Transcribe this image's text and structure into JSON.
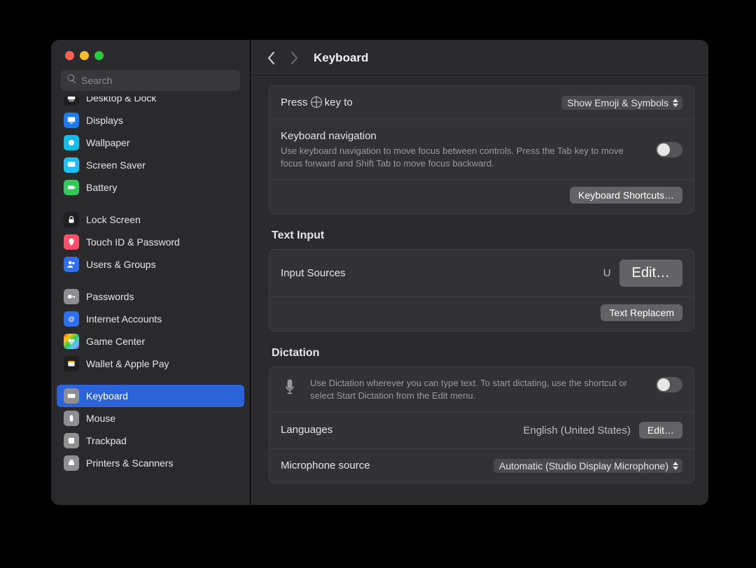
{
  "window": {
    "title": "Keyboard"
  },
  "search": {
    "placeholder": "Search"
  },
  "sidebar": {
    "items": [
      {
        "id": "desktop-dock",
        "label": "Desktop & Dock",
        "icon": "dock",
        "cutoff": true
      },
      {
        "id": "displays",
        "label": "Displays",
        "icon": "disp"
      },
      {
        "id": "wallpaper",
        "label": "Wallpaper",
        "icon": "wall"
      },
      {
        "id": "screensaver",
        "label": "Screen Saver",
        "icon": "ss"
      },
      {
        "id": "battery",
        "label": "Battery",
        "icon": "batt"
      },
      {
        "spacer": true
      },
      {
        "id": "lockscreen",
        "label": "Lock Screen",
        "icon": "lock"
      },
      {
        "id": "touchid",
        "label": "Touch ID & Password",
        "icon": "touch"
      },
      {
        "id": "users",
        "label": "Users & Groups",
        "icon": "users"
      },
      {
        "spacer": true
      },
      {
        "id": "passwords",
        "label": "Passwords",
        "icon": "pass"
      },
      {
        "id": "internet-accounts",
        "label": "Internet Accounts",
        "icon": "netacc"
      },
      {
        "id": "gamecenter",
        "label": "Game Center",
        "icon": "gc"
      },
      {
        "id": "wallet",
        "label": "Wallet & Apple Pay",
        "icon": "wallet"
      },
      {
        "spacer": true
      },
      {
        "id": "keyboard",
        "label": "Keyboard",
        "icon": "kbd",
        "selected": true
      },
      {
        "id": "mouse",
        "label": "Mouse",
        "icon": "mouse"
      },
      {
        "id": "trackpad",
        "label": "Trackpad",
        "icon": "track"
      },
      {
        "id": "printers",
        "label": "Printers & Scanners",
        "icon": "print"
      }
    ]
  },
  "main": {
    "press_globe": {
      "label_prefix": "Press ",
      "label_suffix": " key to",
      "value": "Show Emoji & Symbols"
    },
    "kbnav": {
      "label": "Keyboard navigation",
      "desc": "Use keyboard navigation to move focus between controls. Press the Tab key to move focus forward and Shift Tab to move focus backward."
    },
    "shortcuts_btn": "Keyboard Shortcuts…",
    "text_input": {
      "heading": "Text Input",
      "input_sources_label": "Input Sources",
      "input_sources_value": "U",
      "edit_btn": "Edit…",
      "text_repl_btn": "Text Replacem"
    },
    "dictation": {
      "heading": "Dictation",
      "desc": "Use Dictation wherever you can type text. To start dictating, use the shortcut or select Start Dictation from the Edit menu.",
      "lang_label": "Languages",
      "lang_value": "English (United States)",
      "lang_edit": "Edit…",
      "mic_label": "Microphone source",
      "mic_value": "Automatic (Studio Display Microphone)"
    }
  }
}
